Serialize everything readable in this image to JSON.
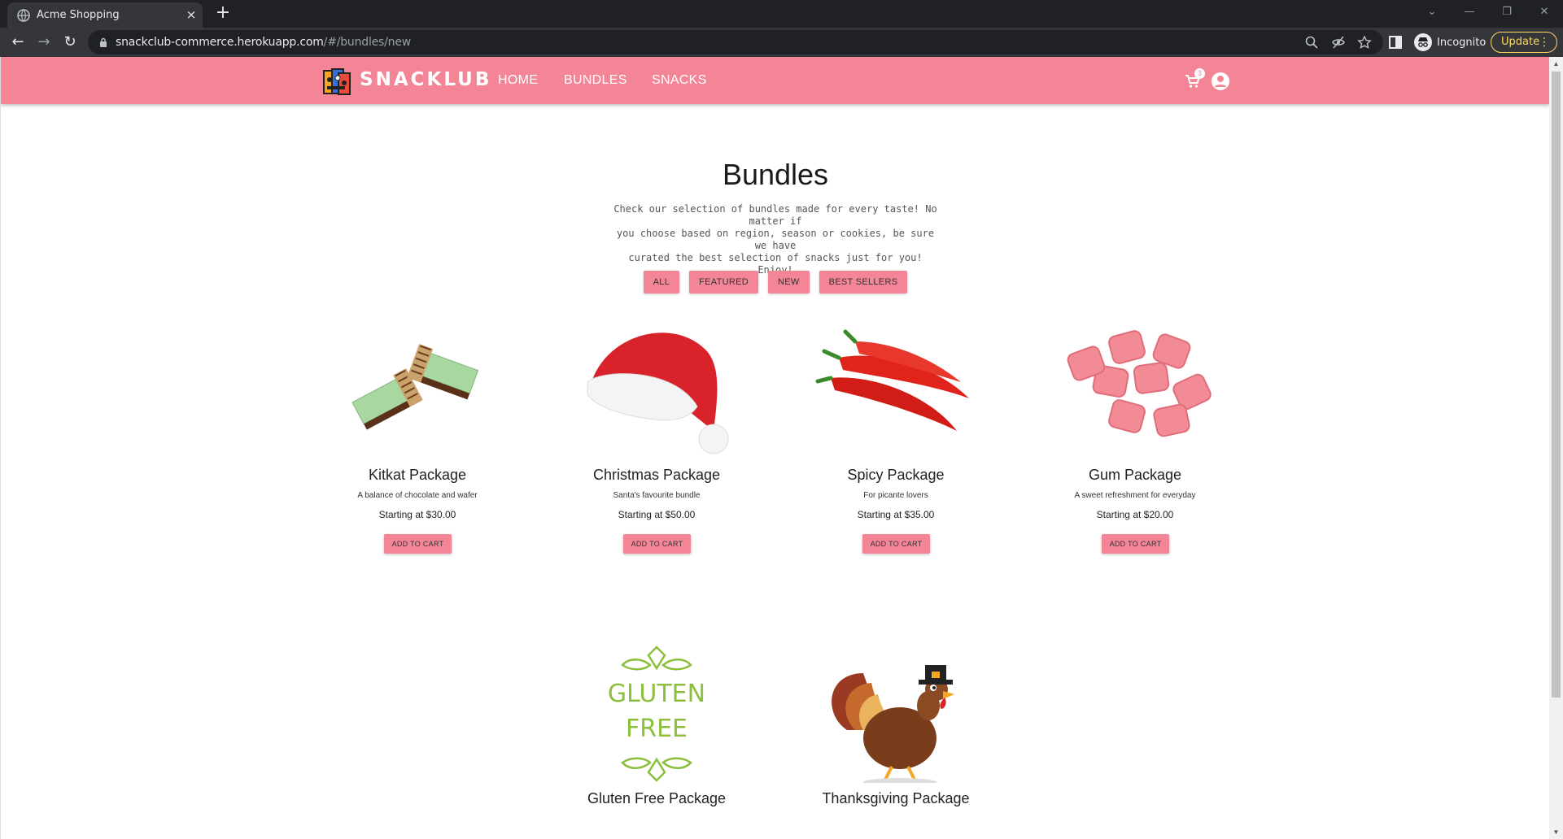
{
  "browser": {
    "tab_title": "Acme Shopping",
    "tab_close": "×",
    "new_tab": "+",
    "url_host": "snackclub-commerce.herokuapp.com",
    "url_path": "/#/bundles/new",
    "incognito_label": "Incognito",
    "update_label": "Update"
  },
  "site": {
    "brand": "SNACKLUB",
    "nav": [
      "HOME",
      "BUNDLES",
      "SNACKS"
    ],
    "cart_count": "3"
  },
  "page": {
    "title": "Bundles",
    "intro": [
      "Check our selection of bundles made for every taste! No matter if",
      "you choose based on region, season or cookies, be sure we have",
      "curated the best selection of snacks just for you!",
      "Enjoy!"
    ],
    "filters": [
      "ALL",
      "FEATURED",
      "NEW",
      "BEST SELLERS"
    ]
  },
  "bundles": [
    {
      "name": "Kitkat Package",
      "desc": "A balance of chocolate and wafer",
      "price": "Starting at $30.00",
      "button": "ADD TO CART",
      "image": "kitkat"
    },
    {
      "name": "Christmas Package",
      "desc": "Santa's favourite bundle",
      "price": "Starting at $50.00",
      "button": "ADD TO CART",
      "image": "santa-hat"
    },
    {
      "name": "Spicy Package",
      "desc": "For picante lovers",
      "price": "Starting at $35.00",
      "button": "ADD TO CART",
      "image": "chili-peppers"
    },
    {
      "name": "Gum Package",
      "desc": "A sweet refreshment for everyday",
      "price": "Starting at $20.00",
      "button": "ADD TO CART",
      "image": "gum"
    },
    {
      "name": "Gluten Free Package",
      "image": "gluten-free",
      "logo_text": [
        "GLUTEN",
        "FREE"
      ]
    },
    {
      "name": "Thanksgiving Package",
      "image": "turkey"
    }
  ],
  "colors": {
    "brand_pink": "#f48597",
    "chrome_dark": "#202124",
    "chrome_toolbar": "#35363a",
    "update_yellow": "#fdd663"
  }
}
